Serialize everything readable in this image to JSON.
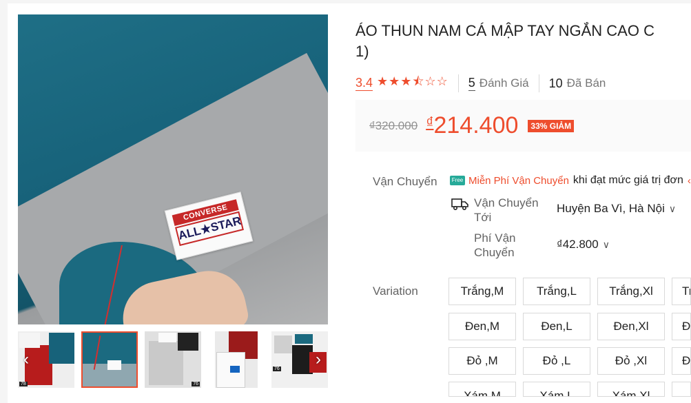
{
  "product": {
    "title_line1": "ÁO THUN NAM CÁ MẬP TAY NGẮN CAO C",
    "title_line2": "1)",
    "tag_brand_top": "CONVERSE",
    "tag_brand_bottom": "ALL★STAR"
  },
  "thumbnails": [
    {
      "num": "78",
      "active": false
    },
    {
      "num": "",
      "active": true
    },
    {
      "num": "76",
      "active": false
    },
    {
      "num": "",
      "active": false
    },
    {
      "num": "76",
      "active": false
    }
  ],
  "nav": {
    "prev": "‹",
    "next": "›"
  },
  "rating": {
    "value": "3.4",
    "stars": "★★★",
    "half_star": "⯪",
    "empty_stars": "☆☆",
    "review_count": "5",
    "review_label": "Đánh Giá",
    "sold_count": "10",
    "sold_label": "Đã Bán"
  },
  "price": {
    "original": "₫320.000",
    "currency": "₫",
    "current": "214.400",
    "discount_badge": "33% GIẢM"
  },
  "shipping": {
    "label": "Vận Chuyển",
    "free_badge": "Free",
    "free_text": "Miễn Phí Vận Chuyển",
    "condition": "khi đạt mức giá trị đơn",
    "destination_label_1": "Vận Chuyển",
    "destination_label_2": "Tới",
    "destination_value": "Huyện Ba Vì, Hà Nội",
    "fee_label_1": "Phí Vận",
    "fee_label_2": "Chuyển",
    "fee_value": "₫42.800"
  },
  "variation": {
    "label": "Variation",
    "options": [
      [
        "Trắng,M",
        "Trắng,L",
        "Trắng,Xl",
        "Tr"
      ],
      [
        "Đen,M",
        "Đen,L",
        "Đen,Xl",
        "Đ"
      ],
      [
        "Đỏ ,M",
        "Đỏ ,L",
        "Đỏ ,Xl",
        "Đ"
      ],
      [
        "Xám,M",
        "Xám,L",
        "Xám,Xl",
        ""
      ]
    ]
  },
  "colors": {
    "accent": "#ee4d2d",
    "teal": "#26aa99",
    "shirt": "#17627a"
  }
}
